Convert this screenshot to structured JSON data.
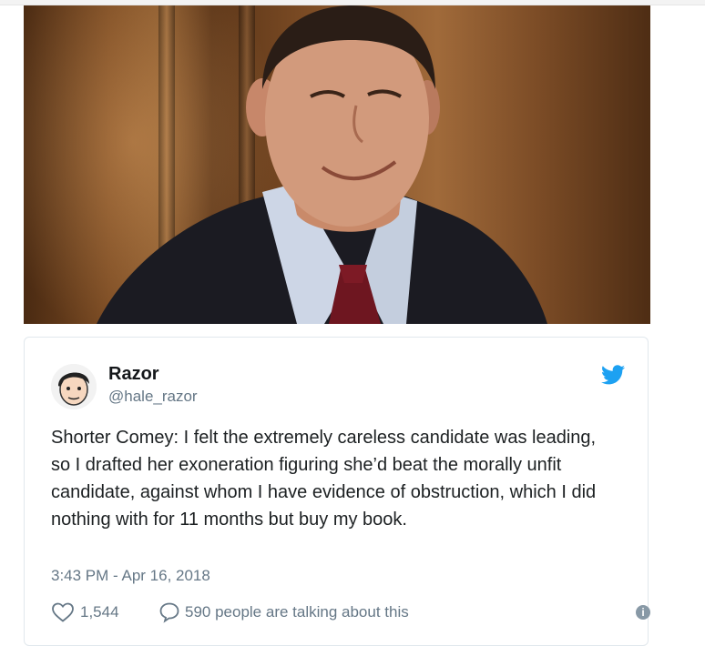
{
  "tweet": {
    "author_name": "Razor",
    "author_handle": "@hale_razor",
    "text": "Shorter Comey: I felt the extremely careless candidate was leading, so I drafted her exoneration figuring she’d beat the morally unfit candidate, against whom I have evidence of obstruction, which I did nothing with for 11 months but buy my book.",
    "timestamp": "3:43 PM - Apr 16, 2018",
    "like_count": "1,544",
    "talking_text": "590 people are talking about this"
  },
  "icons": {
    "brand": "twitter-bird-icon",
    "like": "heart-icon",
    "reply": "speech-bubble-icon",
    "info": "info-icon"
  },
  "colors": {
    "twitter_blue": "#1da1f2",
    "secondary_text": "#657786",
    "primary_text": "#14171a",
    "card_border": "#e1e8ed"
  }
}
